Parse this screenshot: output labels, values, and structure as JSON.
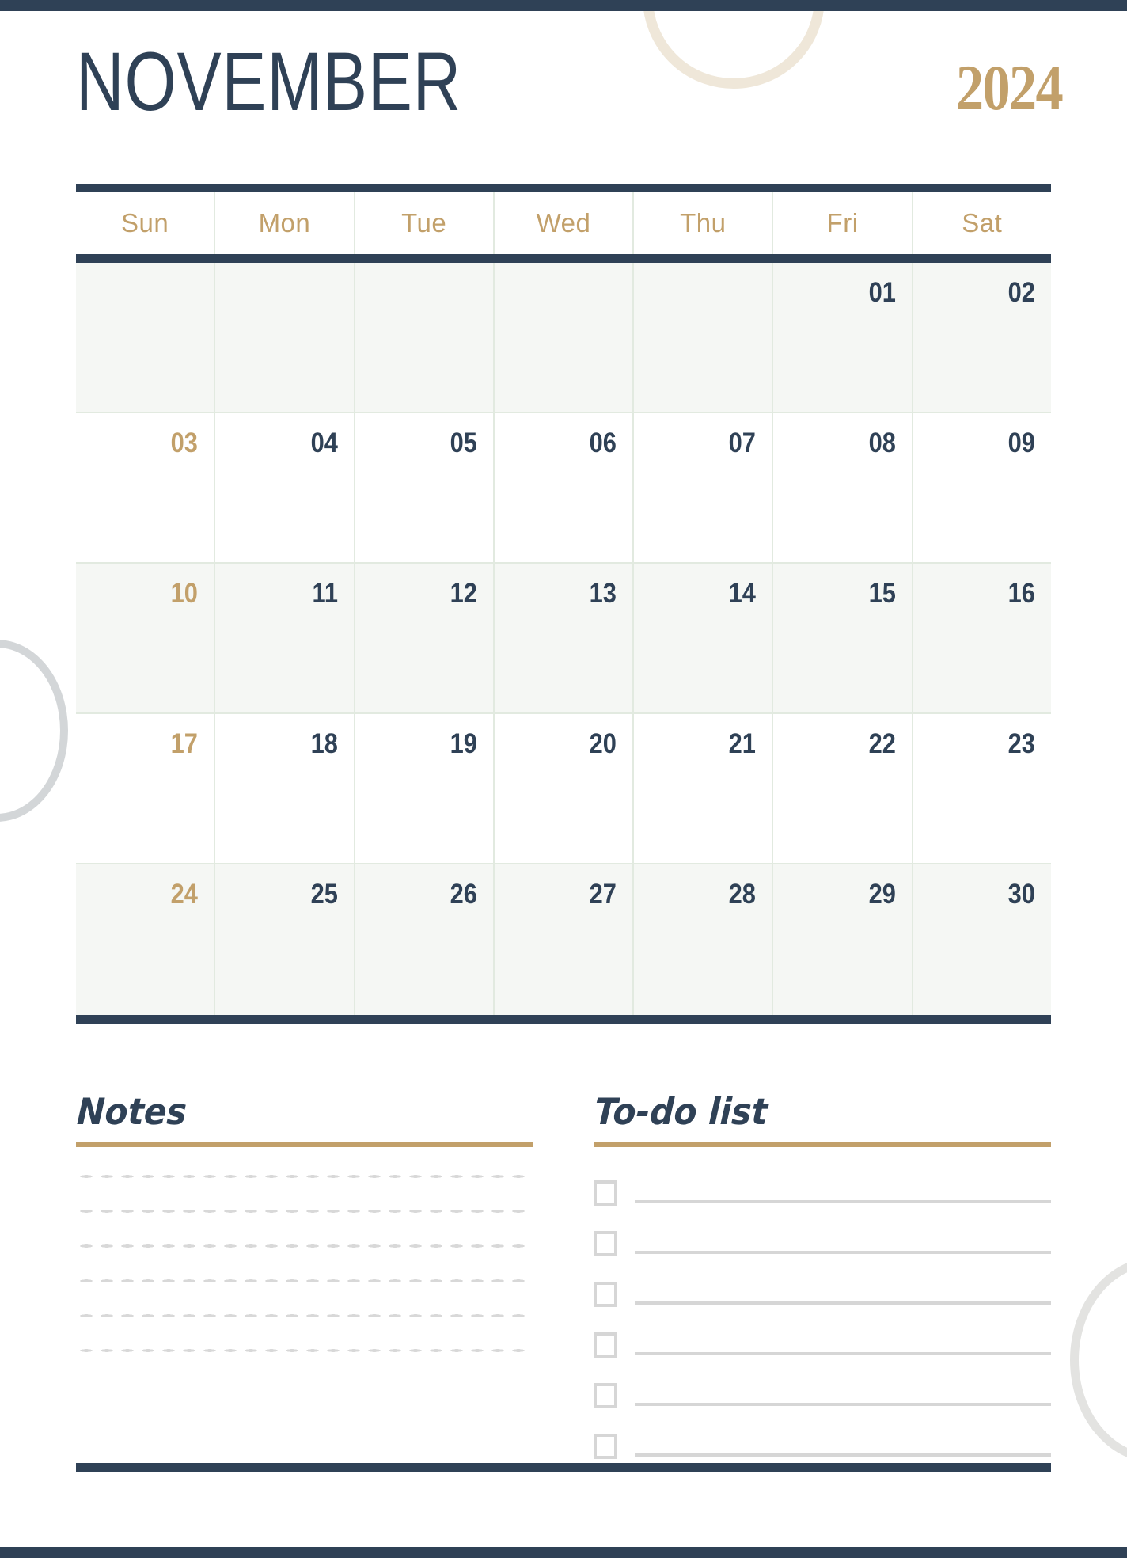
{
  "theme": {
    "navy": "#2F4156",
    "gold": "#C2A06A",
    "grid_line": "#E2EAE0",
    "shaded_cell": "#F5F7F4",
    "line_grey": "#D6D6D6",
    "ring_beige": "#EFE7D9"
  },
  "header": {
    "month": "NOVEMBER",
    "year": "2024"
  },
  "calendar": {
    "weekdays": [
      "Sun",
      "Mon",
      "Tue",
      "Wed",
      "Thu",
      "Fri",
      "Sat"
    ],
    "weeks": [
      [
        "",
        "",
        "",
        "",
        "",
        "01",
        "02"
      ],
      [
        "03",
        "04",
        "05",
        "06",
        "07",
        "08",
        "09"
      ],
      [
        "10",
        "11",
        "12",
        "13",
        "14",
        "15",
        "16"
      ],
      [
        "17",
        "18",
        "19",
        "20",
        "21",
        "22",
        "23"
      ],
      [
        "24",
        "25",
        "26",
        "27",
        "28",
        "29",
        "30"
      ]
    ]
  },
  "notes": {
    "title": "Notes",
    "line_count": 6
  },
  "todo": {
    "title": "To-do list",
    "items": [
      "",
      "",
      "",
      "",
      "",
      ""
    ]
  }
}
